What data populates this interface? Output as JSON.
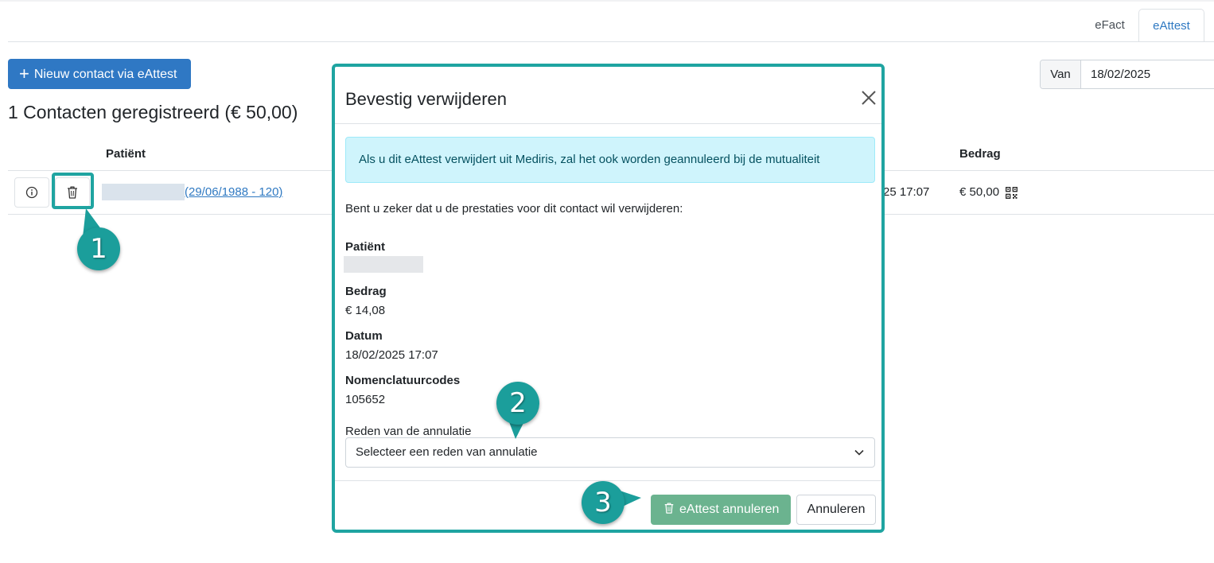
{
  "tabs": [
    {
      "label": "eFact",
      "active": false
    },
    {
      "label": "eAttest",
      "active": true
    }
  ],
  "toolbar": {
    "new_contact_label": "Nieuw contact via eAttest",
    "date_filter_label": "Van",
    "date_filter_value": "18/02/2025"
  },
  "summary": {
    "title": "1 Contacten geregistreerd (€ 50,00)"
  },
  "table": {
    "headers": {
      "patient": "Patiënt",
      "amount": "Bedrag"
    },
    "rows": [
      {
        "patient_link": "(29/06/1988 - 120)",
        "date_fragment": "25 17:07",
        "amount": "€ 50,00"
      }
    ]
  },
  "markers": [
    "1",
    "2",
    "3"
  ],
  "modal": {
    "title": "Bevestig verwijderen",
    "alert": "Als u dit eAttest verwijdert uit Mediris, zal het ook worden geannuleerd bij de mutualiteit",
    "question": "Bent u zeker dat u de prestaties voor dit contact wil verwijderen:",
    "fields": {
      "patient_label": "Patiënt",
      "amount_label": "Bedrag",
      "amount_value": "€ 14,08",
      "date_label": "Datum",
      "date_value": "18/02/2025 17:07",
      "codes_label": "Nomenclatuurcodes",
      "codes_value": "105652"
    },
    "reason_label": "Reden van de annulatie",
    "reason_placeholder": "Selecteer een reden van annulatie",
    "confirm_label": "eAttest annuleren",
    "cancel_label": "Annuleren"
  },
  "colors": {
    "primary": "#2f78c4",
    "highlight_teal": "#1fa4a1",
    "alert_bg": "#cff4fc",
    "confirm_green": "#6bb38f"
  }
}
